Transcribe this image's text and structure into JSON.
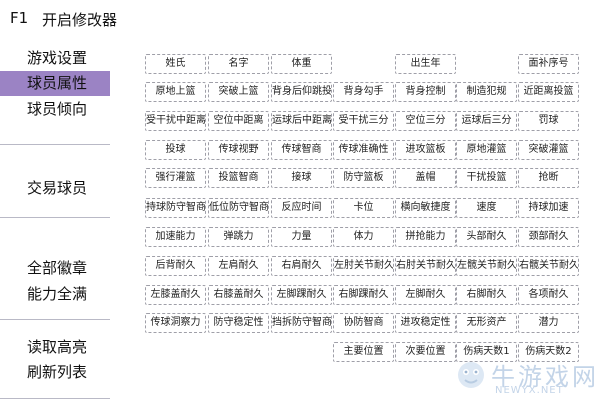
{
  "titlebar": {
    "key": "F1",
    "name": "开启修改器"
  },
  "sidebar": {
    "items": [
      {
        "label": "游戏设置",
        "active": false
      },
      {
        "label": "球员属性",
        "active": true
      },
      {
        "label": "球员倾向",
        "active": false
      },
      {
        "label": "交易球员",
        "active": false
      },
      {
        "label": "全部徽章",
        "active": false
      },
      {
        "label": "能力全满",
        "active": false
      },
      {
        "label": "读取高亮",
        "active": false
      },
      {
        "label": "刷新列表",
        "active": false
      }
    ]
  },
  "grid": {
    "rows": [
      [
        "姓氏",
        "名字",
        "体重",
        "",
        "出生年",
        "",
        "面补序号"
      ],
      [
        "原地上篮",
        "突破上篮",
        "背身后仰跳投",
        "背身勾手",
        "背身控制",
        "制造犯规",
        "近距离投篮"
      ],
      [
        "受干扰中距离",
        "空位中距离",
        "运球后中距离",
        "受干扰三分",
        "空位三分",
        "运球后三分",
        "罚球"
      ],
      [
        "投球",
        "传球视野",
        "传球智商",
        "传球准确性",
        "进攻篮板",
        "原地灌篮",
        "突破灌篮"
      ],
      [
        "强行灌篮",
        "投篮智商",
        "接球",
        "防守篮板",
        "盖帽",
        "干扰投篮",
        "抢断"
      ],
      [
        "持球防守智商",
        "低位防守智商",
        "反应时间",
        "卡位",
        "横向敏捷度",
        "速度",
        "持球加速"
      ],
      [
        "加速能力",
        "弹跳力",
        "力量",
        "体力",
        "拼抢能力",
        "头部耐久",
        "颈部耐久"
      ],
      [
        "后背耐久",
        "左肩耐久",
        "右肩耐久",
        "左肘关节耐久",
        "右肘关节耐久",
        "左髋关节耐久",
        "右髋关节耐久"
      ],
      [
        "左膝盖耐久",
        "右膝盖耐久",
        "左脚踝耐久",
        "右脚踝耐久",
        "左脚耐久",
        "右脚耐久",
        "各项耐久"
      ],
      [
        "传球洞察力",
        "防守稳定性",
        "挡拆防守智商",
        "协防智商",
        "进攻稳定性",
        "无形资产",
        "潜力"
      ],
      [
        "",
        "",
        "",
        "主要位置",
        "次要位置",
        "伤病天数1",
        "伤病天数2"
      ]
    ]
  },
  "watermark": {
    "text": "牛游戏网",
    "url": "NEWYX.NET"
  },
  "colors": {
    "accent": "#9b83c4",
    "cell_border": "#9f9fa8",
    "divider": "#b9b9c6"
  }
}
